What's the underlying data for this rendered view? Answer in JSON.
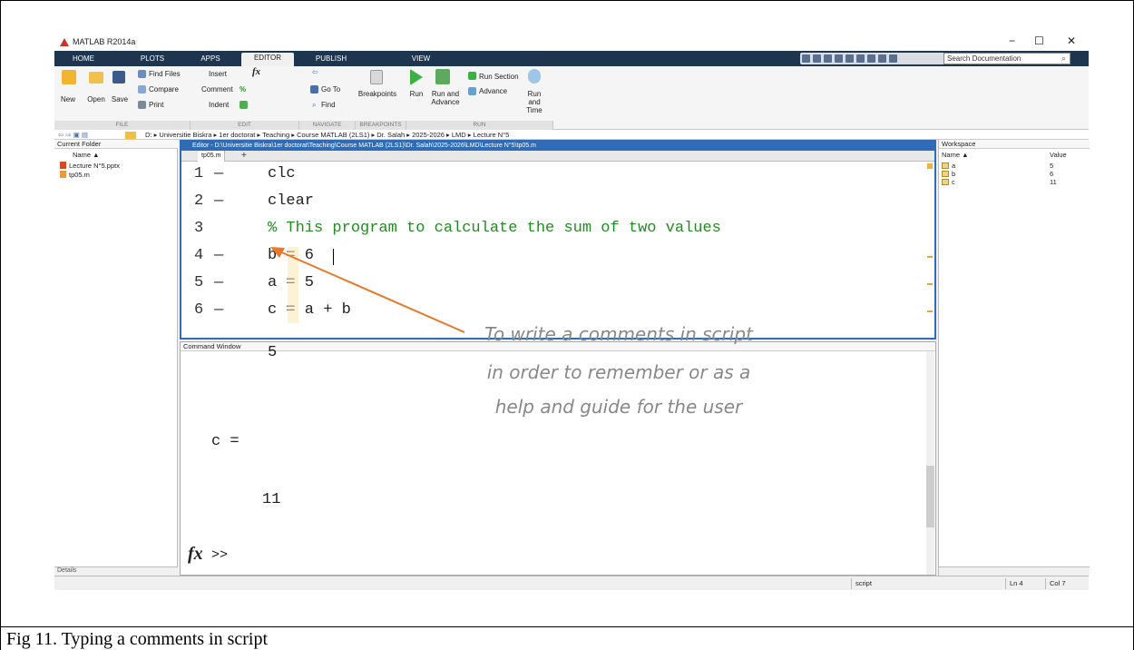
{
  "caption": "Fig 11. Typing a comments in script",
  "app": {
    "title": "MATLAB R2014a",
    "window_controls": [
      "−",
      "☐",
      "✕"
    ]
  },
  "ribbon_tabs": [
    "HOME",
    "PLOTS",
    "APPS",
    "EDITOR",
    "PUBLISH",
    "VIEW"
  ],
  "active_tab": "EDITOR",
  "search_placeholder": "Search Documentation",
  "ribbon": {
    "file": {
      "new": "New",
      "open": "Open",
      "save": "Save",
      "find_files": "Find Files",
      "compare": "Compare",
      "print": "Print",
      "section": "FILE"
    },
    "edit": {
      "insert": "Insert",
      "fx": "fx",
      "comment": "Comment",
      "indent": "Indent",
      "section": "EDIT"
    },
    "navigate": {
      "go_to": "Go To",
      "find": "Find",
      "section": "NAVIGATE"
    },
    "breakpoints": {
      "label": "Breakpoints",
      "section": "BREAKPOINTS"
    },
    "run": {
      "run": "Run",
      "run_and_advance": "Run and Advance",
      "run_section": "Run Section",
      "advance": "Advance",
      "run_and_time": "Run and Time",
      "section": "RUN"
    }
  },
  "path": "D: ▸ Universitie Biskra ▸ 1er doctorat ▸ Teaching ▸ Course MATLAB (2LS1) ▸ Dr. Salah ▸ 2025-2026 ▸ LMD ▸ Lecture N°5",
  "current_folder": {
    "title": "Current Folder",
    "column": "Name ▲",
    "files": [
      "Lecture N°5.pptx",
      "tp05.m"
    ],
    "details_label": "Details"
  },
  "editor": {
    "title": "Editor - D:\\Universitie Biskra\\1er doctorat\\Teaching\\Course MATLAB (2LS1)\\Dr. Salah\\2025-2026\\LMD\\Lecture N°5\\tp05.m",
    "tab": "tp05.m",
    "lines": [
      {
        "num": "1",
        "dash": "—",
        "text": "clc"
      },
      {
        "num": "2",
        "dash": "—",
        "text": "clear"
      },
      {
        "num": "3",
        "dash": "",
        "text": "% This program to calculate the sum of two values"
      },
      {
        "num": "4",
        "dash": "—",
        "text": "b = 6"
      },
      {
        "num": "5",
        "dash": "—",
        "text": "a = 5"
      },
      {
        "num": "6",
        "dash": "—",
        "text": "c = a + b"
      }
    ]
  },
  "command_window": {
    "title": "Command Window",
    "partial": "5",
    "result_label": "c =",
    "result_value": "11",
    "fx": "fx",
    "prompt": ">>"
  },
  "workspace": {
    "title": "Workspace",
    "col_name": "Name ▲",
    "col_value": "Value",
    "vars": [
      {
        "name": "a",
        "value": "5"
      },
      {
        "name": "b",
        "value": "6"
      },
      {
        "name": "c",
        "value": "11"
      }
    ]
  },
  "status": {
    "mode": "script",
    "ln": "Ln  4",
    "col": "Col  7"
  },
  "annotation": {
    "line1": "To write a comments in script",
    "line2": "in order to remember or as a",
    "line3": "help and guide for the user"
  },
  "colors": {
    "accent": "#2f6cb5",
    "ribbon_tab_bg": "#1e3550",
    "comment": "#228b22",
    "annotation_arrow": "#e8782a"
  }
}
